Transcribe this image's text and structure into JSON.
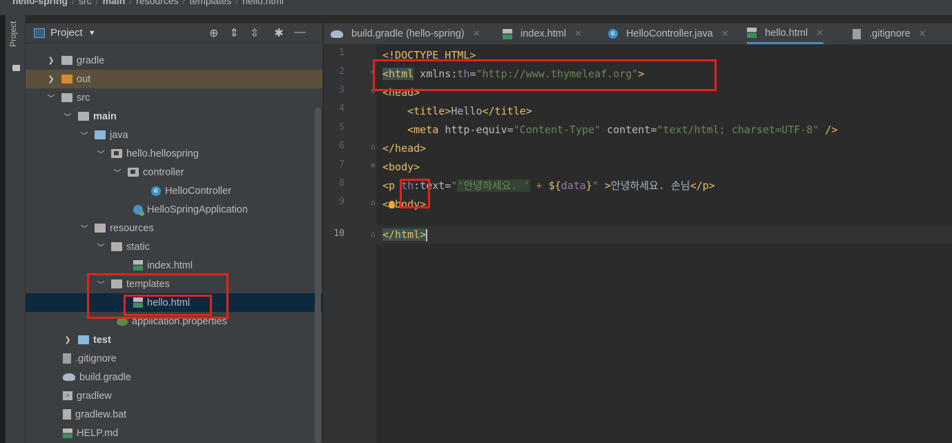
{
  "breadcrumb": {
    "items": [
      "hello-spring",
      "src",
      "main",
      "resources",
      "templates",
      "hello.html"
    ]
  },
  "tool_strip": {
    "project_label": "Project"
  },
  "project_panel": {
    "title": "Project",
    "tree": [
      {
        "label": "gradle",
        "arrow": ">",
        "icon": "folder-icon"
      },
      {
        "label": "out",
        "arrow": ">",
        "icon": "folder-orange-icon"
      },
      {
        "label": "src",
        "arrow": "v",
        "icon": "folder-icon"
      },
      {
        "label": "main",
        "arrow": "v",
        "icon": "folder-icon"
      },
      {
        "label": "java",
        "arrow": "v",
        "icon": "folder-blue-icon"
      },
      {
        "label": "hello.hellospring",
        "arrow": "v",
        "icon": "package-icon"
      },
      {
        "label": "controller",
        "arrow": "v",
        "icon": "package-icon"
      },
      {
        "label": "HelloController",
        "arrow": "",
        "icon": "class-icon"
      },
      {
        "label": "HelloSpringApplication",
        "arrow": "",
        "icon": "spring-app-icon"
      },
      {
        "label": "resources",
        "arrow": "v",
        "icon": "resources-folder-icon"
      },
      {
        "label": "static",
        "arrow": "v",
        "icon": "folder-icon"
      },
      {
        "label": "index.html",
        "arrow": "",
        "icon": "html-file-icon"
      },
      {
        "label": "templates",
        "arrow": "v",
        "icon": "folder-icon"
      },
      {
        "label": "hello.html",
        "arrow": "",
        "icon": "html-file-icon"
      },
      {
        "label": "application.properties",
        "arrow": "",
        "icon": "properties-icon"
      },
      {
        "label": "test",
        "arrow": ">",
        "icon": "folder-blue-icon"
      },
      {
        "label": ".gitignore",
        "arrow": "",
        "icon": "gitignore-icon"
      },
      {
        "label": "build.gradle",
        "arrow": "",
        "icon": "gradle-icon"
      },
      {
        "label": "gradlew",
        "arrow": "",
        "icon": "terminal-file-icon"
      },
      {
        "label": "gradlew.bat",
        "arrow": "",
        "icon": "file-icon"
      },
      {
        "label": "HELP.md",
        "arrow": "",
        "icon": "markdown-icon"
      }
    ]
  },
  "tabs": [
    {
      "label": "build.gradle (hello-spring)",
      "icon": "gradle-icon",
      "active": false
    },
    {
      "label": "index.html",
      "icon": "html-file-icon",
      "active": false
    },
    {
      "label": "HelloController.java",
      "icon": "class-icon",
      "active": false
    },
    {
      "label": "hello.html",
      "icon": "html-file-icon",
      "active": true
    },
    {
      "label": ".gitignore",
      "icon": "gitignore-icon",
      "active": false
    }
  ],
  "editor": {
    "line_numbers": [
      "1",
      "2",
      "3",
      "4",
      "5",
      "6",
      "7",
      "8",
      "9",
      "10"
    ],
    "current_line": "10",
    "lines": {
      "l1": {
        "a": "<!DOCTYPE HTML>"
      },
      "l2": {
        "a": "<html",
        "b": " xmlns:",
        "c": "th",
        "d": "=",
        "e": "\"http://www.thymeleaf.org\"",
        "f": ">"
      },
      "l3": {
        "a": "<head>"
      },
      "l4": {
        "a": "    ",
        "b": "<title>",
        "c": "Hello",
        "d": "</title>"
      },
      "l5": {
        "a": "    ",
        "b": "<meta ",
        "c": "http-equiv",
        "d": "=",
        "e": "\"Content-Type\"",
        "f": " content",
        "g": "=",
        "h": "\"text/html; charset=UTF-8\"",
        "i": " />"
      },
      "l6": {
        "a": "</head>"
      },
      "l7": {
        "a": "<body>"
      },
      "l8": {
        "a": "<p ",
        "b": "th",
        "c": ":text",
        "d": "=",
        "e": "\"",
        "f": "'안녕하세요. '",
        "g": " + ",
        "h": "${",
        "i": "data",
        "j": "}",
        "k": "\"",
        "l": " >",
        "m": "안녕하세요. 손님",
        "n": "</p>"
      },
      "l9": {
        "a": "<",
        "b": "body>"
      },
      "l10": {
        "a": "</html>"
      }
    }
  },
  "annotations": {
    "color": "#e5231b",
    "count": 4
  },
  "colors": {
    "background": "#2b2b2b",
    "panel": "#3c3f41",
    "selected_row": "#0d293e",
    "tag": "#e8bf6a",
    "string": "#6a8759",
    "namespace": "#9876aa",
    "active_tab_underline": "#4a88c7"
  }
}
